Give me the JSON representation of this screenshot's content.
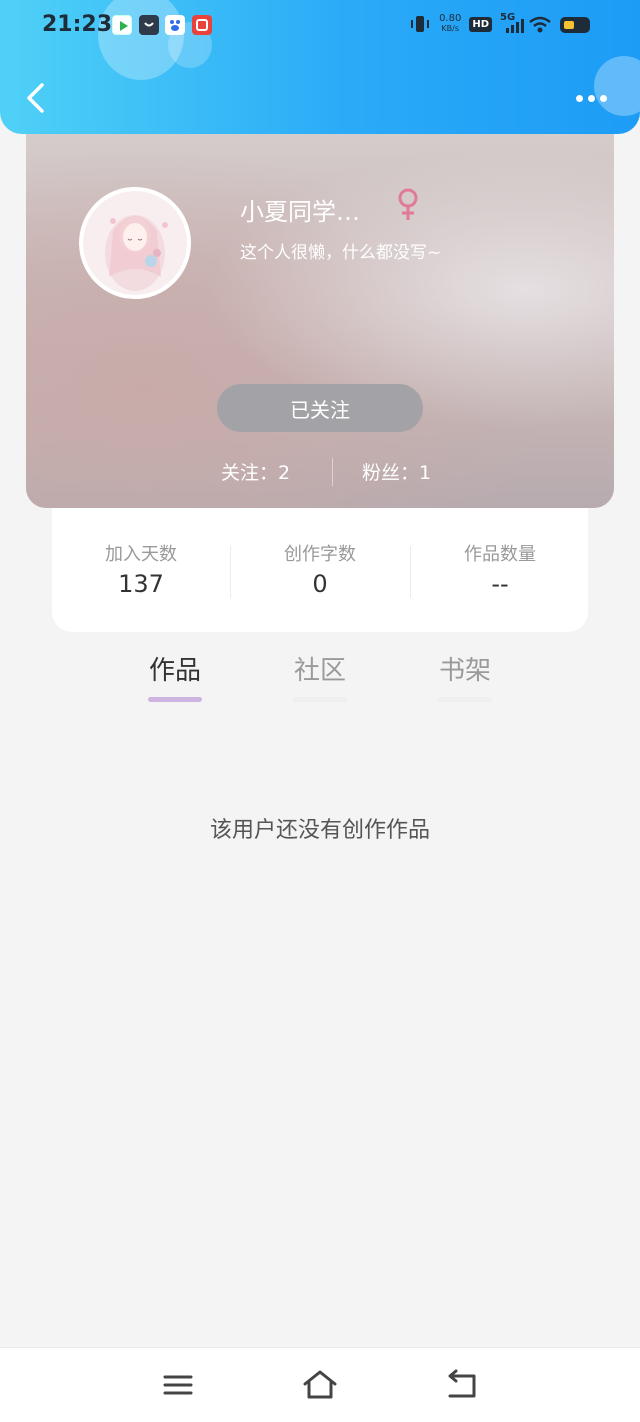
{
  "status_bar": {
    "time": "21:23",
    "net_speed_value": "0.80",
    "net_speed_unit": "KB/s",
    "hd_label": "HD",
    "network_label": "5G"
  },
  "profile": {
    "nickname": "小夏同学…",
    "bio": "这个人很懒，什么都没写~",
    "follow_button_label": "已关注",
    "following_text": "关注：2",
    "followers_text": "粉丝：1"
  },
  "stats": [
    {
      "label": "加入天数",
      "value": "137"
    },
    {
      "label": "创作字数",
      "value": "0"
    },
    {
      "label": "作品数量",
      "value": "--"
    }
  ],
  "tabs": [
    {
      "label": "作品",
      "active": true
    },
    {
      "label": "社区",
      "active": false
    },
    {
      "label": "书架",
      "active": false
    }
  ],
  "empty_message": "该用户还没有创作作品",
  "colors": {
    "header_gradient_start": "#4fd1f7",
    "header_gradient_end": "#1d9cf6",
    "gender_female": "#e07a96",
    "active_tab_indicator": "#cdb3e0"
  },
  "icons": {
    "back": "chevron-left-icon",
    "more": "more-dots-icon",
    "gender": "female-icon",
    "nav_menu": "menu-icon",
    "nav_home": "home-icon",
    "nav_back": "return-icon"
  }
}
